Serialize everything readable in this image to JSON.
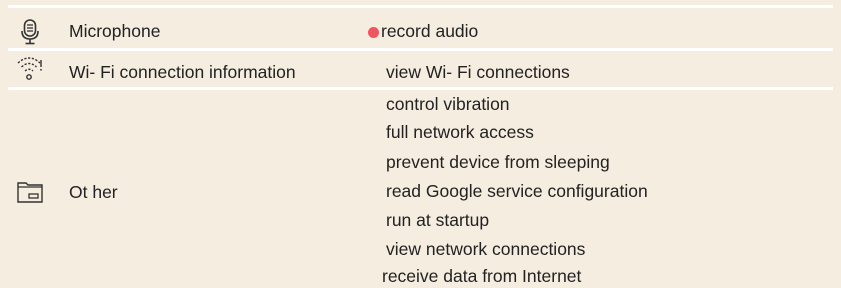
{
  "colors": {
    "background": "#f5ede0",
    "divider": "#ffffff",
    "text": "#222222",
    "warning_dot": "#ef5561"
  },
  "groups": [
    {
      "icon": "microphone-icon",
      "label": "Microphone",
      "permissions": [
        {
          "text": "record audio",
          "flagged": true
        }
      ]
    },
    {
      "icon": "wifi-icon",
      "label": "Wi- Fi connection information",
      "permissions": [
        {
          "text": "view Wi- Fi connections",
          "flagged": false
        }
      ]
    },
    {
      "icon": "folder-icon",
      "label": "Ot her",
      "permissions": [
        {
          "text": "control vibration",
          "flagged": false
        },
        {
          "text": "full network access",
          "flagged": false
        },
        {
          "text": "prevent device from sleeping",
          "flagged": false
        },
        {
          "text": "read Google service configuration",
          "flagged": false
        },
        {
          "text": "run at startup",
          "flagged": false
        },
        {
          "text": "view network connections",
          "flagged": false
        },
        {
          "text": "receive data from Internet",
          "flagged": false
        }
      ]
    }
  ]
}
